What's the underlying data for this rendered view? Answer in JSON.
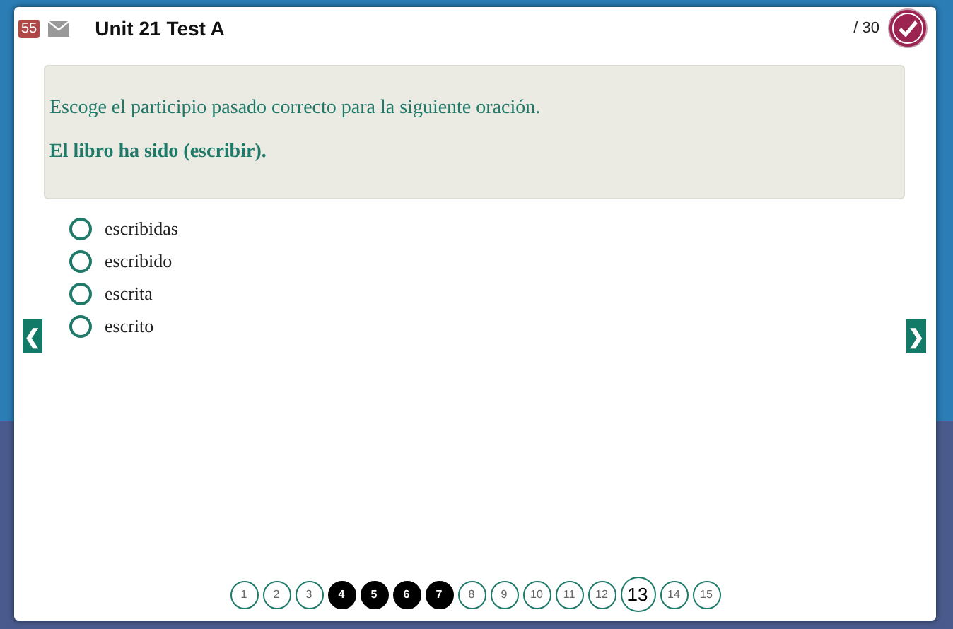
{
  "header": {
    "badge": "55",
    "title": "Unit 21  Test A",
    "score": "/ 30"
  },
  "question": {
    "prompt": "Escoge el participio pasado correcto para la siguiente oración.",
    "sentence": "El libro ha sido (escribir)."
  },
  "options": [
    {
      "label": "escribidas",
      "selected": false
    },
    {
      "label": "escribido",
      "selected": false
    },
    {
      "label": "escrita",
      "selected": false
    },
    {
      "label": "escrito",
      "selected": false
    }
  ],
  "nav": {
    "prev": "❮",
    "next": "❯"
  },
  "pages": [
    {
      "label": "1",
      "answered": false,
      "selected": false
    },
    {
      "label": "2",
      "answered": false,
      "selected": false
    },
    {
      "label": "3",
      "answered": false,
      "selected": false
    },
    {
      "label": "4",
      "answered": true,
      "selected": false
    },
    {
      "label": "5",
      "answered": true,
      "selected": false
    },
    {
      "label": "6",
      "answered": true,
      "selected": false
    },
    {
      "label": "7",
      "answered": true,
      "selected": false
    },
    {
      "label": "8",
      "answered": false,
      "selected": false
    },
    {
      "label": "9",
      "answered": false,
      "selected": false
    },
    {
      "label": "10",
      "answered": false,
      "selected": false
    },
    {
      "label": "11",
      "answered": false,
      "selected": false
    },
    {
      "label": "12",
      "answered": false,
      "selected": false
    },
    {
      "label": "13",
      "answered": false,
      "selected": true
    },
    {
      "label": "14",
      "answered": false,
      "selected": false
    },
    {
      "label": "15",
      "answered": false,
      "selected": false
    }
  ]
}
